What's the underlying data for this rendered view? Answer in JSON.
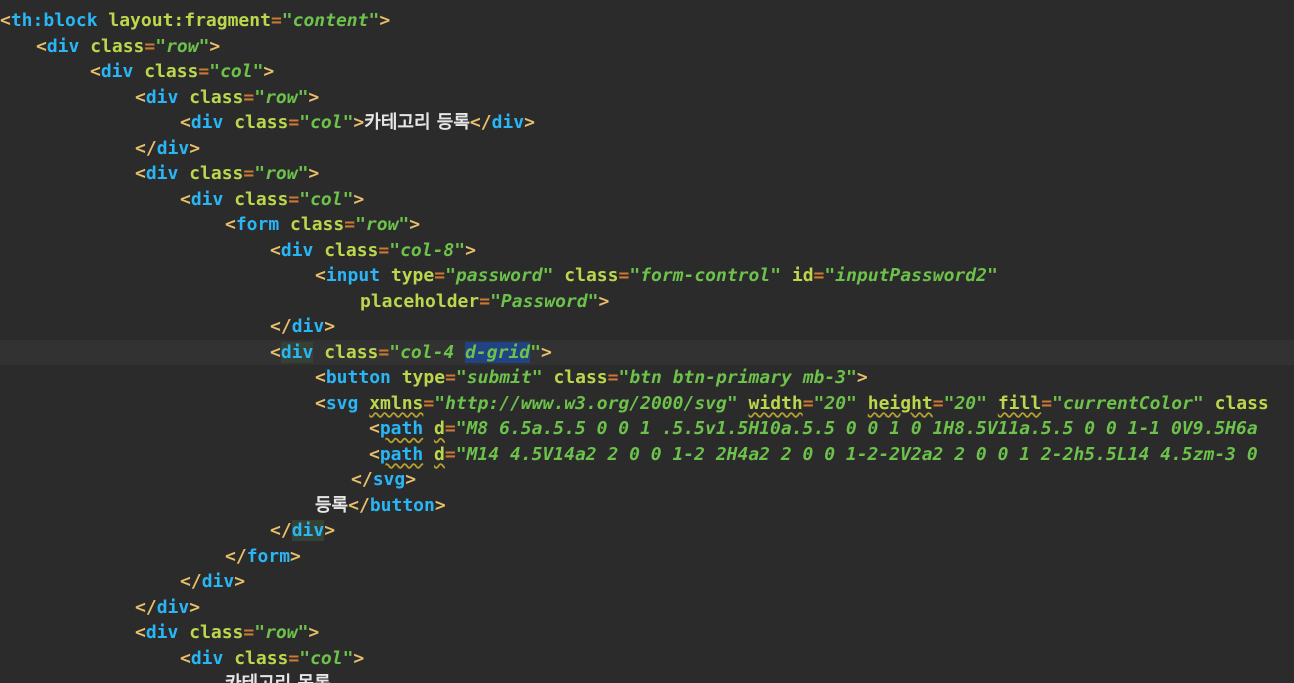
{
  "editor": {
    "theme_colors": {
      "background": "#2b2b2b",
      "current_line": "#323232",
      "tag": "#29b6f6",
      "attribute": "#bbd74c",
      "string": "#6cc24a",
      "text": "#e6e6e6",
      "selection": "#214283"
    },
    "lines": [
      {
        "indent": 0,
        "segments": [
          {
            "t": "<",
            "c": "br"
          },
          {
            "t": "th:block",
            "c": "tag"
          },
          {
            "t": " layout:fragment",
            "c": "attr"
          },
          {
            "t": "=",
            "c": "eq"
          },
          {
            "t": "\"content\"",
            "c": "str"
          },
          {
            "t": ">",
            "c": "br"
          }
        ]
      },
      {
        "indent": 4,
        "segments": [
          {
            "t": "<",
            "c": "br"
          },
          {
            "t": "div",
            "c": "tag"
          },
          {
            "t": " class",
            "c": "attr"
          },
          {
            "t": "=",
            "c": "eq"
          },
          {
            "t": "\"row\"",
            "c": "str"
          },
          {
            "t": ">",
            "c": "br"
          }
        ]
      },
      {
        "indent": 10,
        "segments": [
          {
            "t": "<",
            "c": "br"
          },
          {
            "t": "div",
            "c": "tag"
          },
          {
            "t": " class",
            "c": "attr"
          },
          {
            "t": "=",
            "c": "eq"
          },
          {
            "t": "\"col\"",
            "c": "str"
          },
          {
            "t": ">",
            "c": "br"
          }
        ]
      },
      {
        "indent": 15,
        "segments": [
          {
            "t": "<",
            "c": "br"
          },
          {
            "t": "div",
            "c": "tag"
          },
          {
            "t": " class",
            "c": "attr"
          },
          {
            "t": "=",
            "c": "eq"
          },
          {
            "t": "\"row\"",
            "c": "str"
          },
          {
            "t": ">",
            "c": "br"
          }
        ]
      },
      {
        "indent": 20,
        "segments": [
          {
            "t": "<",
            "c": "br"
          },
          {
            "t": "div",
            "c": "tag"
          },
          {
            "t": " class",
            "c": "attr"
          },
          {
            "t": "=",
            "c": "eq"
          },
          {
            "t": "\"col\"",
            "c": "str"
          },
          {
            "t": ">",
            "c": "br"
          },
          {
            "t": "카테고리 등록",
            "c": "txt"
          },
          {
            "t": "</",
            "c": "br"
          },
          {
            "t": "div",
            "c": "tag"
          },
          {
            "t": ">",
            "c": "br"
          }
        ]
      },
      {
        "indent": 15,
        "segments": [
          {
            "t": "</",
            "c": "br"
          },
          {
            "t": "div",
            "c": "tag"
          },
          {
            "t": ">",
            "c": "br"
          }
        ]
      },
      {
        "indent": 15,
        "segments": [
          {
            "t": "<",
            "c": "br"
          },
          {
            "t": "div",
            "c": "tag"
          },
          {
            "t": " class",
            "c": "attr"
          },
          {
            "t": "=",
            "c": "eq"
          },
          {
            "t": "\"row\"",
            "c": "str"
          },
          {
            "t": ">",
            "c": "br"
          }
        ]
      },
      {
        "indent": 20,
        "segments": [
          {
            "t": "<",
            "c": "br"
          },
          {
            "t": "div",
            "c": "tag"
          },
          {
            "t": " class",
            "c": "attr"
          },
          {
            "t": "=",
            "c": "eq"
          },
          {
            "t": "\"col\"",
            "c": "str"
          },
          {
            "t": ">",
            "c": "br"
          }
        ]
      },
      {
        "indent": 25,
        "segments": [
          {
            "t": "<",
            "c": "br"
          },
          {
            "t": "form",
            "c": "tag"
          },
          {
            "t": " class",
            "c": "attr"
          },
          {
            "t": "=",
            "c": "eq"
          },
          {
            "t": "\"row\"",
            "c": "str"
          },
          {
            "t": ">",
            "c": "br"
          }
        ]
      },
      {
        "indent": 30,
        "segments": [
          {
            "t": "<",
            "c": "br"
          },
          {
            "t": "div",
            "c": "tag"
          },
          {
            "t": " class",
            "c": "attr"
          },
          {
            "t": "=",
            "c": "eq"
          },
          {
            "t": "\"col-8\"",
            "c": "str"
          },
          {
            "t": ">",
            "c": "br"
          }
        ]
      },
      {
        "indent": 35,
        "segments": [
          {
            "t": "<",
            "c": "br"
          },
          {
            "t": "input",
            "c": "tag"
          },
          {
            "t": " type",
            "c": "attr"
          },
          {
            "t": "=",
            "c": "eq"
          },
          {
            "t": "\"password\"",
            "c": "str"
          },
          {
            "t": " class",
            "c": "attr"
          },
          {
            "t": "=",
            "c": "eq"
          },
          {
            "t": "\"form-control\"",
            "c": "str"
          },
          {
            "t": " id",
            "c": "attr"
          },
          {
            "t": "=",
            "c": "eq"
          },
          {
            "t": "\"inputPassword2\"",
            "c": "str"
          }
        ]
      },
      {
        "indent": 40,
        "segments": [
          {
            "t": "placeholder",
            "c": "attr"
          },
          {
            "t": "=",
            "c": "eq"
          },
          {
            "t": "\"Password\"",
            "c": "str"
          },
          {
            "t": ">",
            "c": "br"
          }
        ]
      },
      {
        "indent": 30,
        "segments": [
          {
            "t": "</",
            "c": "br"
          },
          {
            "t": "div",
            "c": "tag"
          },
          {
            "t": ">",
            "c": "br"
          }
        ]
      },
      {
        "indent": 30,
        "current": true,
        "segments": [
          {
            "t": "<",
            "c": "br"
          },
          {
            "t": "div",
            "c": "tagh"
          },
          {
            "t": " class",
            "c": "attr"
          },
          {
            "t": "=",
            "c": "eq"
          },
          {
            "t": "\"col-4 ",
            "c": "str"
          },
          {
            "t": "d-grid",
            "c": "strsel"
          },
          {
            "t": "\"",
            "c": "str"
          },
          {
            "t": ">",
            "c": "br"
          }
        ]
      },
      {
        "indent": 35,
        "segments": [
          {
            "t": "<",
            "c": "br"
          },
          {
            "t": "button",
            "c": "tag"
          },
          {
            "t": " type",
            "c": "attr"
          },
          {
            "t": "=",
            "c": "eq"
          },
          {
            "t": "\"submit\"",
            "c": "str"
          },
          {
            "t": " class",
            "c": "attr"
          },
          {
            "t": "=",
            "c": "eq"
          },
          {
            "t": "\"btn btn-primary mb-3\"",
            "c": "str"
          },
          {
            "t": ">",
            "c": "br"
          }
        ]
      },
      {
        "indent": 35,
        "segments": [
          {
            "t": "<",
            "c": "br"
          },
          {
            "t": "svg",
            "c": "tag"
          },
          {
            "t": " ",
            "c": "attr"
          },
          {
            "t": "xmlns",
            "c": "warn"
          },
          {
            "t": "=",
            "c": "eq"
          },
          {
            "t": "\"http://www.w3.org/2000/svg\"",
            "c": "str"
          },
          {
            "t": " ",
            "c": "attr"
          },
          {
            "t": "width",
            "c": "warn"
          },
          {
            "t": "=",
            "c": "eq"
          },
          {
            "t": "\"20\"",
            "c": "str"
          },
          {
            "t": " ",
            "c": "attr"
          },
          {
            "t": "height",
            "c": "warn"
          },
          {
            "t": "=",
            "c": "eq"
          },
          {
            "t": "\"20\"",
            "c": "str"
          },
          {
            "t": " ",
            "c": "attr"
          },
          {
            "t": "fill",
            "c": "warn"
          },
          {
            "t": "=",
            "c": "eq"
          },
          {
            "t": "\"currentColor\"",
            "c": "str"
          },
          {
            "t": " class",
            "c": "attr"
          }
        ]
      },
      {
        "indent": 41,
        "segments": [
          {
            "t": "<",
            "c": "br"
          },
          {
            "t": "path",
            "c": "warnt"
          },
          {
            "t": " ",
            "c": "attr"
          },
          {
            "t": "d",
            "c": "warn"
          },
          {
            "t": "=",
            "c": "eq"
          },
          {
            "t": "\"M8 6.5a.5.5 0 0 1 .5.5v1.5H10a.5.5 0 0 1 0 1H8.5V11a.5.5 0 0 1-1 0V9.5H6a",
            "c": "str"
          }
        ]
      },
      {
        "indent": 41,
        "segments": [
          {
            "t": "<",
            "c": "br"
          },
          {
            "t": "path",
            "c": "warnt"
          },
          {
            "t": " ",
            "c": "attr"
          },
          {
            "t": "d",
            "c": "warn"
          },
          {
            "t": "=",
            "c": "eq"
          },
          {
            "t": "\"M14 4.5V14a2 2 0 0 1-2 2H4a2 2 0 0 1-2-2V2a2 2 0 0 1 2-2h5.5L14 4.5zm-3 0",
            "c": "str"
          }
        ]
      },
      {
        "indent": 39,
        "segments": [
          {
            "t": "</",
            "c": "br"
          },
          {
            "t": "svg",
            "c": "tag"
          },
          {
            "t": ">",
            "c": "br"
          }
        ]
      },
      {
        "indent": 35,
        "segments": [
          {
            "t": "등록",
            "c": "txt"
          },
          {
            "t": "</",
            "c": "br"
          },
          {
            "t": "button",
            "c": "tag"
          },
          {
            "t": ">",
            "c": "br"
          }
        ]
      },
      {
        "indent": 30,
        "segments": [
          {
            "t": "</",
            "c": "br"
          },
          {
            "t": "div",
            "c": "tagh"
          },
          {
            "t": ">",
            "c": "br"
          }
        ]
      },
      {
        "indent": 25,
        "segments": [
          {
            "t": "</",
            "c": "br"
          },
          {
            "t": "form",
            "c": "tag"
          },
          {
            "t": ">",
            "c": "br"
          }
        ]
      },
      {
        "indent": 20,
        "segments": [
          {
            "t": "</",
            "c": "br"
          },
          {
            "t": "div",
            "c": "tag"
          },
          {
            "t": ">",
            "c": "br"
          }
        ]
      },
      {
        "indent": 15,
        "segments": [
          {
            "t": "</",
            "c": "br"
          },
          {
            "t": "div",
            "c": "tag"
          },
          {
            "t": ">",
            "c": "br"
          }
        ]
      },
      {
        "indent": 15,
        "segments": [
          {
            "t": "<",
            "c": "br"
          },
          {
            "t": "div",
            "c": "tag"
          },
          {
            "t": " class",
            "c": "attr"
          },
          {
            "t": "=",
            "c": "eq"
          },
          {
            "t": "\"row\"",
            "c": "str"
          },
          {
            "t": ">",
            "c": "br"
          }
        ]
      },
      {
        "indent": 20,
        "segments": [
          {
            "t": "<",
            "c": "br"
          },
          {
            "t": "div",
            "c": "tag"
          },
          {
            "t": " class",
            "c": "attr"
          },
          {
            "t": "=",
            "c": "eq"
          },
          {
            "t": "\"col\"",
            "c": "str"
          },
          {
            "t": ">",
            "c": "br"
          }
        ]
      },
      {
        "indent": 25,
        "segments": [
          {
            "t": "카테고리 목록",
            "c": "txt"
          }
        ]
      }
    ]
  }
}
